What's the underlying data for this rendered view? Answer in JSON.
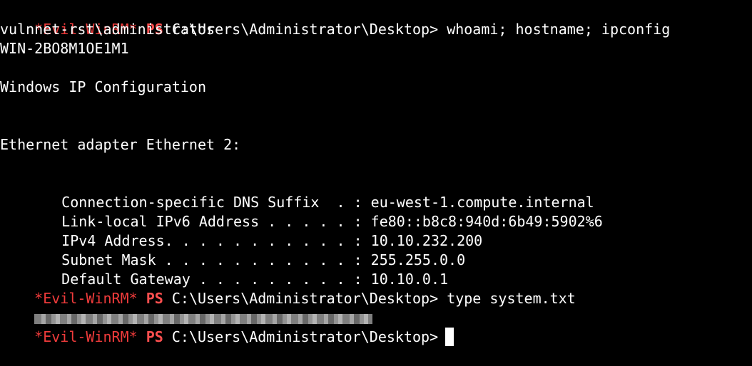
{
  "terminal": {
    "prompt_prefix": "*Evil-WinRM*",
    "prompt_ps": "PS",
    "prompt_path": "C:\\Users\\Administrator\\Desktop>",
    "commands": {
      "first": "whoami; hostname; ipconfig",
      "second": "type system.txt"
    },
    "output": {
      "user": "vulnnet-rst\\administrator",
      "host": "WIN-2BO8M1OE1M1",
      "ipconfig_title": "Windows IP Configuration",
      "adapter": "Ethernet adapter Ethernet 2:",
      "rows": [
        {
          "label": "Connection-specific DNS Suffix  . :",
          "value": "eu-west-1.compute.internal"
        },
        {
          "label": "Link-local IPv6 Address . . . . . :",
          "value": "fe80::b8c8:940d:6b49:5902%6"
        },
        {
          "label": "IPv4 Address. . . . . . . . . . . :",
          "value": "10.10.232.200"
        },
        {
          "label": "Subnet Mask . . . . . . . . . . . :",
          "value": "255.255.0.0"
        },
        {
          "label": "Default Gateway . . . . . . . . . :",
          "value": "10.10.0.1"
        }
      ]
    },
    "colors": {
      "background": "#000000",
      "prompt_red": "#ef3b3b",
      "ps_red": "#ff4f4f",
      "text": "#ffffff"
    }
  }
}
